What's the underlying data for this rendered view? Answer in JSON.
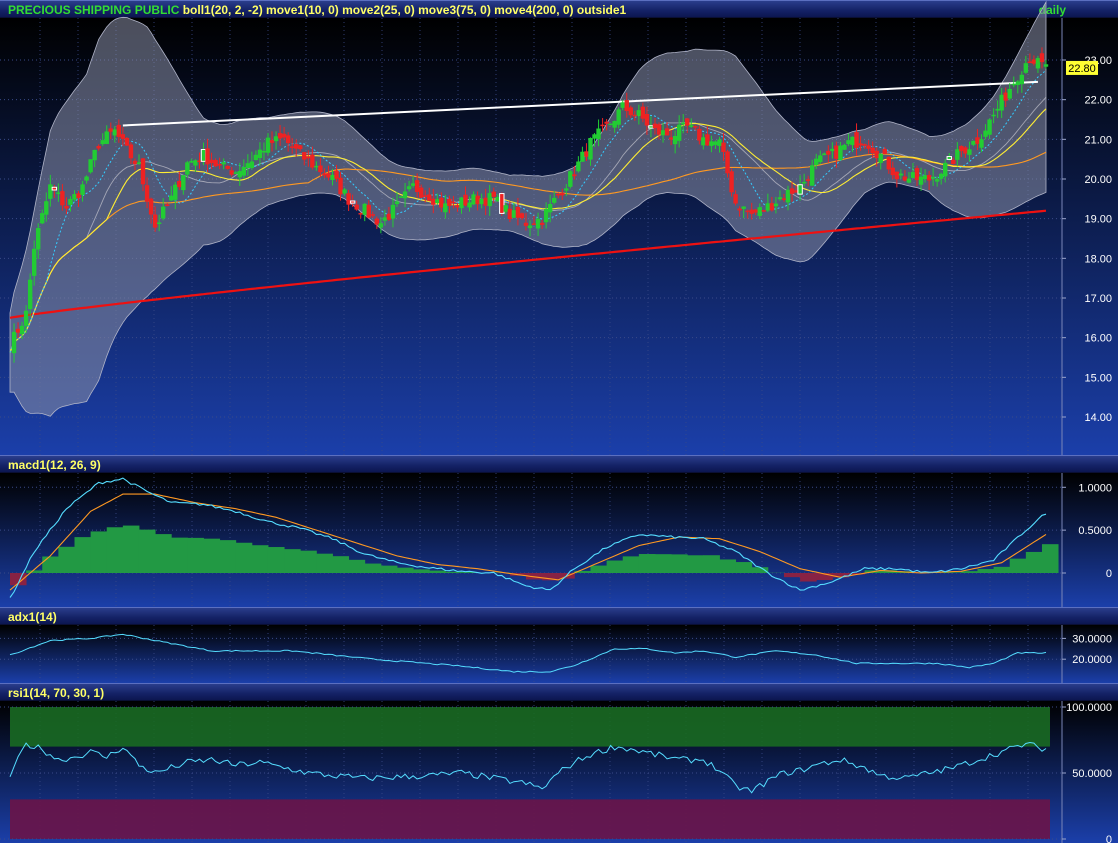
{
  "panels": {
    "price": {
      "symbol": "PRECIOUS SHIPPING PUBLIC",
      "studies": "boll1(20, 2, -2) move1(10, 0) move2(25, 0) move3(75, 0) move4(200, 0) outside1",
      "period": "daily",
      "last_price": "22.80",
      "y_ticks": [
        "14.00",
        "15.00",
        "16.00",
        "17.00",
        "18.00",
        "19.00",
        "20.00",
        "21.00",
        "22.00",
        "23.00"
      ]
    },
    "macd": {
      "label": "macd1(12, 26, 9)",
      "y_ticks": [
        "0",
        "0.5000",
        "1.0000"
      ]
    },
    "adx": {
      "label": "adx1(14)",
      "y_ticks": [
        "20.0000",
        "30.0000"
      ]
    },
    "rsi": {
      "label": "rsi1(14, 70, 30, 1)",
      "y_ticks": [
        "0",
        "50.0000",
        "100.0000"
      ]
    }
  },
  "colors": {
    "up": "#22cc33",
    "down": "#ee2222",
    "ma10": "#33ccff",
    "ma25": "#ffee33",
    "ma75": "#ff9922",
    "ma200": "#ee1111",
    "band": "#8a8fa8",
    "trend": "#ffffff",
    "macd": "#55ddff",
    "signal": "#ff9922",
    "hist_pos": "#229944",
    "hist_neg": "#882244"
  },
  "chart_data": [
    {
      "type": "line",
      "title": "PRECIOUS SHIPPING PUBLIC",
      "ylim": [
        13.3,
        24.0
      ],
      "trendline": [
        [
          28,
          21.35
        ],
        [
          255,
          22.45
        ]
      ],
      "close_waypoints": [
        [
          0,
          15.8
        ],
        [
          4,
          16.6
        ],
        [
          6,
          18.3
        ],
        [
          10,
          19.8
        ],
        [
          14,
          19.3
        ],
        [
          18,
          19.8
        ],
        [
          22,
          20.9
        ],
        [
          26,
          21.2
        ],
        [
          29,
          20.7
        ],
        [
          32,
          20.3
        ],
        [
          36,
          18.8
        ],
        [
          40,
          19.5
        ],
        [
          44,
          20.4
        ],
        [
          48,
          20.6
        ],
        [
          52,
          20.3
        ],
        [
          56,
          20.2
        ],
        [
          60,
          20.5
        ],
        [
          64,
          20.9
        ],
        [
          68,
          21.0
        ],
        [
          72,
          20.6
        ],
        [
          76,
          20.3
        ],
        [
          80,
          20.0
        ],
        [
          84,
          19.5
        ],
        [
          88,
          19.2
        ],
        [
          92,
          18.9
        ],
        [
          96,
          19.3
        ],
        [
          100,
          19.8
        ],
        [
          104,
          19.6
        ],
        [
          108,
          19.3
        ],
        [
          112,
          19.4
        ],
        [
          116,
          19.5
        ],
        [
          120,
          19.5
        ],
        [
          124,
          19.1
        ],
        [
          128,
          18.9
        ],
        [
          132,
          19.0
        ],
        [
          136,
          19.6
        ],
        [
          140,
          20.2
        ],
        [
          144,
          20.9
        ],
        [
          148,
          21.3
        ],
        [
          152,
          21.8
        ],
        [
          156,
          21.6
        ],
        [
          160,
          21.2
        ],
        [
          164,
          21.1
        ],
        [
          168,
          21.3
        ],
        [
          172,
          21.0
        ],
        [
          176,
          20.9
        ],
        [
          180,
          19.4
        ],
        [
          184,
          19.1
        ],
        [
          188,
          19.3
        ],
        [
          192,
          19.6
        ],
        [
          196,
          19.8
        ],
        [
          200,
          20.4
        ],
        [
          204,
          20.6
        ],
        [
          208,
          20.9
        ],
        [
          212,
          21.0
        ],
        [
          216,
          20.6
        ],
        [
          220,
          20.1
        ],
        [
          224,
          20.0
        ],
        [
          228,
          20.0
        ],
        [
          232,
          20.3
        ],
        [
          236,
          20.7
        ],
        [
          240,
          21.0
        ],
        [
          244,
          21.6
        ],
        [
          248,
          22.3
        ],
        [
          251,
          22.8
        ],
        [
          253,
          23.1
        ],
        [
          255,
          22.9
        ],
        [
          257,
          22.8
        ]
      ],
      "bb_width_waypoints": [
        [
          0,
          1.0
        ],
        [
          10,
          3.6
        ],
        [
          22,
          4.3
        ],
        [
          34,
          3.4
        ],
        [
          48,
          1.6
        ],
        [
          64,
          1.1
        ],
        [
          80,
          1.0
        ],
        [
          100,
          0.9
        ],
        [
          124,
          0.7
        ],
        [
          140,
          1.0
        ],
        [
          156,
          1.7
        ],
        [
          168,
          1.8
        ],
        [
          180,
          2.2
        ],
        [
          196,
          1.6
        ],
        [
          212,
          0.8
        ],
        [
          228,
          0.7
        ],
        [
          244,
          1.5
        ],
        [
          257,
          2.4
        ]
      ],
      "series": [
        {
          "name": "boll1(20, 2, -2)"
        },
        {
          "name": "move1(10, 0)"
        },
        {
          "name": "move2(25, 0)"
        },
        {
          "name": "move3(75, 0)"
        },
        {
          "name": "move4(200, 0)"
        }
      ]
    },
    {
      "type": "line",
      "title": "macd1(12, 26, 9)",
      "ylim": [
        -0.35,
        1.12
      ],
      "macd_waypoints": [
        [
          0,
          -0.3
        ],
        [
          6,
          0.25
        ],
        [
          14,
          0.75
        ],
        [
          22,
          1.05
        ],
        [
          28,
          1.1
        ],
        [
          34,
          0.95
        ],
        [
          40,
          0.82
        ],
        [
          48,
          0.8
        ],
        [
          56,
          0.72
        ],
        [
          64,
          0.6
        ],
        [
          72,
          0.52
        ],
        [
          80,
          0.4
        ],
        [
          88,
          0.22
        ],
        [
          96,
          0.12
        ],
        [
          104,
          0.06
        ],
        [
          112,
          0.02
        ],
        [
          120,
          0.0
        ],
        [
          128,
          -0.15
        ],
        [
          134,
          -0.2
        ],
        [
          140,
          0.05
        ],
        [
          148,
          0.3
        ],
        [
          156,
          0.45
        ],
        [
          164,
          0.42
        ],
        [
          172,
          0.4
        ],
        [
          180,
          0.25
        ],
        [
          188,
          0.0
        ],
        [
          196,
          -0.2
        ],
        [
          204,
          -0.1
        ],
        [
          212,
          0.05
        ],
        [
          220,
          0.05
        ],
        [
          228,
          0.0
        ],
        [
          236,
          0.05
        ],
        [
          244,
          0.15
        ],
        [
          252,
          0.5
        ],
        [
          257,
          0.7
        ]
      ],
      "signal_waypoints": [
        [
          0,
          -0.2
        ],
        [
          10,
          0.2
        ],
        [
          20,
          0.72
        ],
        [
          28,
          0.92
        ],
        [
          36,
          0.92
        ],
        [
          46,
          0.82
        ],
        [
          56,
          0.75
        ],
        [
          66,
          0.65
        ],
        [
          76,
          0.5
        ],
        [
          86,
          0.35
        ],
        [
          96,
          0.2
        ],
        [
          106,
          0.1
        ],
        [
          116,
          0.05
        ],
        [
          126,
          -0.02
        ],
        [
          136,
          -0.08
        ],
        [
          146,
          0.12
        ],
        [
          156,
          0.32
        ],
        [
          166,
          0.42
        ],
        [
          176,
          0.4
        ],
        [
          186,
          0.25
        ],
        [
          196,
          0.05
        ],
        [
          206,
          -0.05
        ],
        [
          216,
          0.03
        ],
        [
          226,
          0.0
        ],
        [
          236,
          0.02
        ],
        [
          246,
          0.12
        ],
        [
          257,
          0.45
        ]
      ]
    },
    {
      "type": "line",
      "title": "adx1(14)",
      "ylim": [
        10,
        35
      ],
      "waypoints": [
        [
          0,
          22
        ],
        [
          10,
          29
        ],
        [
          20,
          30
        ],
        [
          28,
          32
        ],
        [
          36,
          29
        ],
        [
          50,
          24
        ],
        [
          70,
          24
        ],
        [
          90,
          20
        ],
        [
          110,
          17
        ],
        [
          125,
          14
        ],
        [
          134,
          14
        ],
        [
          140,
          17
        ],
        [
          150,
          25
        ],
        [
          158,
          25
        ],
        [
          165,
          23
        ],
        [
          172,
          24
        ],
        [
          180,
          21
        ],
        [
          190,
          24
        ],
        [
          200,
          22
        ],
        [
          210,
          18
        ],
        [
          220,
          18
        ],
        [
          230,
          18
        ],
        [
          238,
          16
        ],
        [
          244,
          18
        ],
        [
          250,
          23
        ],
        [
          257,
          23
        ]
      ]
    },
    {
      "type": "line",
      "title": "rsi1(14, 70, 30, 1)",
      "ylim": [
        0,
        100
      ],
      "bands": [
        30,
        70
      ],
      "waypoints": [
        [
          0,
          48
        ],
        [
          4,
          72
        ],
        [
          8,
          68
        ],
        [
          12,
          60
        ],
        [
          16,
          62
        ],
        [
          20,
          66
        ],
        [
          24,
          62
        ],
        [
          28,
          70
        ],
        [
          32,
          56
        ],
        [
          36,
          50
        ],
        [
          40,
          54
        ],
        [
          44,
          58
        ],
        [
          50,
          60
        ],
        [
          56,
          56
        ],
        [
          62,
          58
        ],
        [
          68,
          54
        ],
        [
          74,
          50
        ],
        [
          80,
          48
        ],
        [
          88,
          46
        ],
        [
          96,
          47
        ],
        [
          104,
          48
        ],
        [
          112,
          50
        ],
        [
          120,
          46
        ],
        [
          128,
          42
        ],
        [
          132,
          38
        ],
        [
          136,
          50
        ],
        [
          140,
          58
        ],
        [
          144,
          64
        ],
        [
          150,
          70
        ],
        [
          154,
          68
        ],
        [
          160,
          64
        ],
        [
          166,
          60
        ],
        [
          172,
          60
        ],
        [
          176,
          52
        ],
        [
          180,
          40
        ],
        [
          184,
          36
        ],
        [
          188,
          44
        ],
        [
          192,
          50
        ],
        [
          196,
          52
        ],
        [
          200,
          56
        ],
        [
          206,
          60
        ],
        [
          212,
          54
        ],
        [
          216,
          48
        ],
        [
          222,
          46
        ],
        [
          228,
          50
        ],
        [
          234,
          54
        ],
        [
          240,
          60
        ],
        [
          246,
          66
        ],
        [
          252,
          72
        ],
        [
          257,
          68
        ]
      ]
    }
  ]
}
